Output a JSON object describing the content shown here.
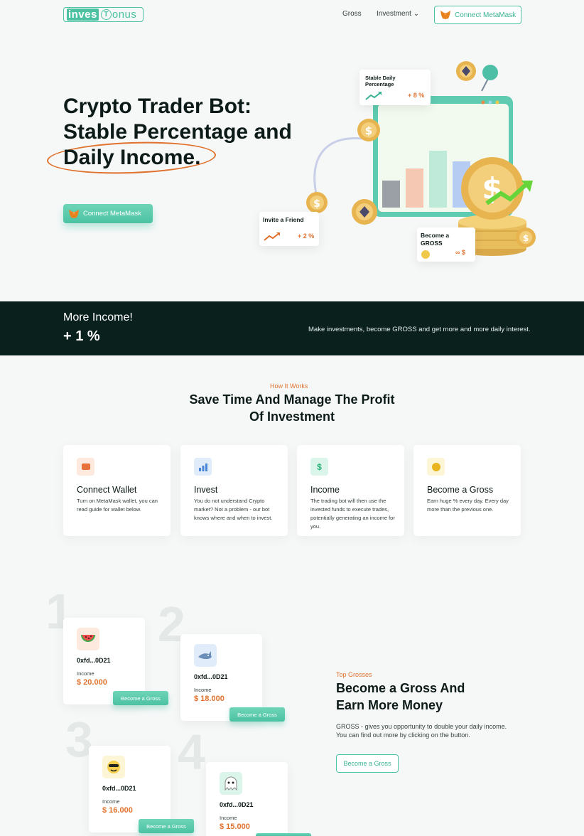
{
  "nav": {
    "logo_left": "inves",
    "logo_mid": "T",
    "logo_right": "onus",
    "links": [
      "Gross",
      "Investment"
    ],
    "investment_caret": "⌄",
    "connect_label": "Connect MetaMask"
  },
  "hero": {
    "title_line1": "Crypto Trader Bot:",
    "title_line2": "Stable Percentage and",
    "title_line3": "Daily Income.",
    "button_label": "Connect MetaMask",
    "cards": {
      "stable_title": "Stable Daily Percentage",
      "stable_pct": "+ 8 %",
      "invite_title": "Invite a Friend",
      "invite_pct": "+ 2 %",
      "gross_title": "Become a GROSS",
      "gross_val": "∞ $"
    }
  },
  "banner": {
    "heading": "More Income!",
    "value": "+ 1 %",
    "text": "Make investments, become GROSS and get more and more daily interest."
  },
  "how": {
    "kicker": "How It Works",
    "title_line1": "Save Time And Manage The Profit",
    "title_line2": "Of Investment",
    "steps": [
      {
        "title": "Connect Wallet",
        "desc": "Turn on MetaMask wallet, you can read guide for wallet below.",
        "icon": "wallet-icon",
        "color": "#fde9de",
        "glyph": "▬",
        "glyph_color": "#e8703a"
      },
      {
        "title": "Invest",
        "desc": "You do not understand Crypto market? Not a problem - our bot knows where and when to invest.",
        "icon": "bar-chart-icon",
        "color": "#e1ecfb",
        "glyph": "▟",
        "glyph_color": "#4a86d8"
      },
      {
        "title": "Income",
        "desc": "The trading bot will then use the invested funds to execute trades, potentially generating an income for you.",
        "icon": "money-icon",
        "color": "#dcf5ea",
        "glyph": "$",
        "glyph_color": "#2db37a"
      },
      {
        "title": "Become a Gross",
        "desc": "Earn huge % every day. Every day more than the previous one.",
        "icon": "medal-icon",
        "color": "#fdf6d6",
        "glyph": "✪",
        "glyph_color": "#e8b521"
      }
    ]
  },
  "top": {
    "kicker": "Top Grosses",
    "title_line1": "Become a Gross And",
    "title_line2": "Earn More Money",
    "desc": "GROSS - gives you opportunity to double your daily income. You can find out more by clicking on the button.",
    "button_label": "Become a Gross",
    "numbers": [
      "1",
      "2",
      "3",
      "4"
    ],
    "cards": [
      {
        "addr": "0xfd...0D21",
        "label": "Income",
        "value": "$ 20.000",
        "button": "Become a Gross",
        "icon": "watermelon-icon",
        "glyph": "🍉",
        "bg": "#fde9de"
      },
      {
        "addr": "0xfd...0D21",
        "label": "Income",
        "value": "$ 18.000",
        "button": "Become a Gross",
        "icon": "shark-icon",
        "glyph": "🦈",
        "bg": "#e1ecfb"
      },
      {
        "addr": "0xfd...0D21",
        "label": "Income",
        "value": "$ 16.000",
        "button": "Become a Gross",
        "icon": "cool-face-icon",
        "glyph": "😎",
        "bg": "#fdf6d6"
      },
      {
        "addr": "0xfd...0D21",
        "label": "Income",
        "value": "$ 15.000",
        "button": "",
        "icon": "ghost-icon",
        "glyph": "👻",
        "bg": "#dcf5ea"
      }
    ]
  }
}
